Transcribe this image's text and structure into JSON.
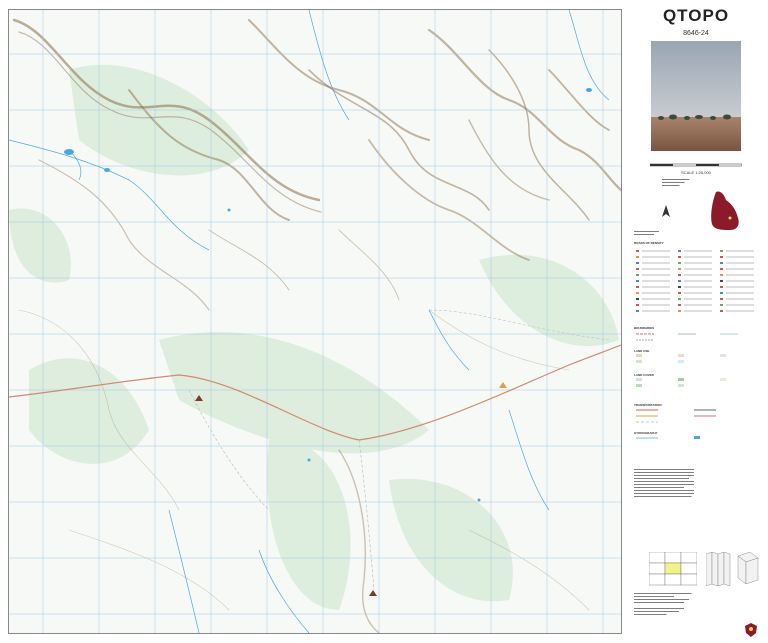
{
  "header": {
    "title": "QTOPO",
    "sheet_number": "8646-24"
  },
  "scale": {
    "label": "SCALE 1:25,000"
  },
  "legend": {
    "sections": [
      "ROADS OF DENSITY",
      "BOUNDARIES",
      "LAND USE",
      "LAND COVER",
      "TRANSPORTATION",
      "HYDROGRAPHY"
    ]
  },
  "map": {
    "features": [
      {
        "name": "homestead",
        "icon": "home-icon"
      },
      {
        "name": "tank",
        "icon": "tank-icon"
      },
      {
        "name": "landmark",
        "icon": "triangle-icon"
      }
    ],
    "colors": {
      "contour": "#8a6d4a",
      "water": "#4aa8e0",
      "vegetation": "#cfe6cf",
      "road": "#d08a70",
      "grid": "#9ac8e8"
    }
  },
  "location_map": {
    "region_color": "#8b1a2b"
  },
  "diagrams": {
    "adjoining": "",
    "layout": ""
  },
  "footer": {
    "text": ""
  }
}
